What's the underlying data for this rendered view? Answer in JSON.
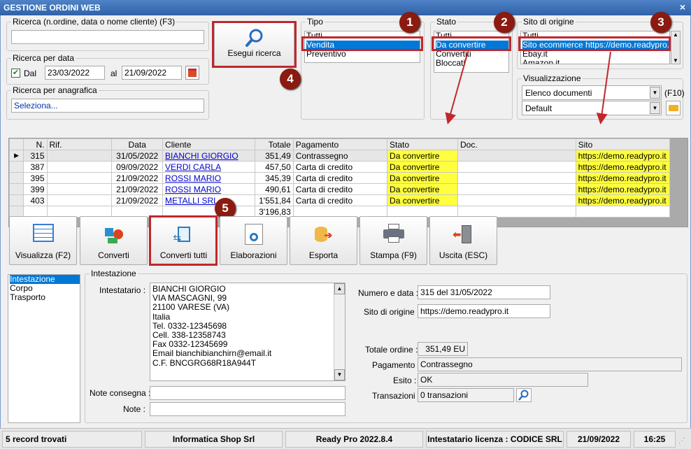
{
  "window": {
    "title": "GESTIONE ORDINI WEB",
    "close": "×"
  },
  "ricerca": {
    "label": "Ricerca (n.ordine, data o nome cliente) (F3)",
    "value": ""
  },
  "ricerca_data": {
    "label": "Ricerca per data",
    "dal_label": "Dal",
    "dal": "23/03/2022",
    "al_label": "al",
    "al": "21/09/2022",
    "dal_checked": true
  },
  "anagrafica": {
    "label": "Ricerca per anagrafica",
    "value": "Seleziona..."
  },
  "search_button": "Esegui ricerca",
  "tipo": {
    "label": "Tipo",
    "items": [
      "Tutti",
      "Vendita",
      "Preventivo"
    ],
    "selected": "Vendita"
  },
  "stato": {
    "label": "Stato",
    "items": [
      "Tutti",
      "Da convertire",
      "Convertiti",
      "Bloccati"
    ],
    "selected": "Da convertire"
  },
  "sito": {
    "label": "Sito di origine",
    "items": [
      "Tutti",
      "Sito ecommerce https://demo.readypro.it",
      "Ebay.it",
      "Amazon.it"
    ],
    "selected": "Sito ecommerce https://demo.readypro.it"
  },
  "visualizzazione": {
    "label": "Visualizzazione",
    "combo1": "Elenco documenti",
    "f10": "(F10)",
    "combo2": "Default"
  },
  "badges": [
    "1",
    "2",
    "3",
    "4",
    "5"
  ],
  "grid": {
    "columns": [
      "N.",
      "Rif.",
      "Data",
      "Cliente",
      "Totale",
      "Pagamento",
      "Stato",
      "Doc.",
      "Sito"
    ],
    "rows": [
      {
        "n": "315",
        "rif": "",
        "data": "31/05/2022",
        "cliente": "BIANCHI GIORGIO",
        "totale": "351,49",
        "pagamento": "Contrassegno",
        "stato": "Da convertire",
        "doc": "",
        "sito": "https://demo.readypro.it"
      },
      {
        "n": "387",
        "rif": "",
        "data": "09/09/2022",
        "cliente": "VERDI CARLA",
        "totale": "457,50",
        "pagamento": "Carta di credito",
        "stato": "Da convertire",
        "doc": "",
        "sito": "https://demo.readypro.it"
      },
      {
        "n": "395",
        "rif": "",
        "data": "21/09/2022",
        "cliente": "ROSSI MARIO",
        "totale": "345,39",
        "pagamento": "Carta di credito",
        "stato": "Da convertire",
        "doc": "",
        "sito": "https://demo.readypro.it"
      },
      {
        "n": "399",
        "rif": "",
        "data": "21/09/2022",
        "cliente": "ROSSI MARIO",
        "totale": "490,61",
        "pagamento": "Carta di credito",
        "stato": "Da convertire",
        "doc": "",
        "sito": "https://demo.readypro.it"
      },
      {
        "n": "403",
        "rif": "",
        "data": "21/09/2022",
        "cliente": "METALLI SRL",
        "totale": "1'551,84",
        "pagamento": "Carta di credito",
        "stato": "Da convertire",
        "doc": "",
        "sito": "https://demo.readypro.it"
      }
    ],
    "total": "3'196,83"
  },
  "toolbar": [
    "Visualizza (F2)",
    "Converti",
    "Converti tutti",
    "Elaborazioni",
    "Esporta",
    "Stampa (F9)",
    "Uscita (ESC)"
  ],
  "nav": [
    "Intestazione",
    "Corpo",
    "Trasporto"
  ],
  "detail": {
    "group_label": "Intestazione",
    "intestatario_label": "Intestatario :",
    "intestatario_lines": [
      "BIANCHI GIORGIO",
      "VIA MASCAGNI, 99",
      "21100 VARESE (VA)",
      "Italia",
      "Tel. 0332-12345698",
      "Cell. 338-12358743",
      "Fax 0332-12345699",
      "Email bianchibianchirn@email.it",
      "C.F. BNCGRG68R18A944T"
    ],
    "note_consegna_label": "Note consegna :",
    "note_consegna": "",
    "note_label": "Note :",
    "note": "",
    "numero_label": "Numero e data :",
    "numero": "315 del 31/05/2022",
    "sito_label": "Sito di origine :",
    "sito": "https://demo.readypro.it",
    "totale_label": "Totale ordine :",
    "totale": "351,49 EU",
    "pagamento_label": "Pagamento :",
    "pagamento": "Contrassegno",
    "esito_label": "Esito :",
    "esito": "OK",
    "transazioni_label": "Transazioni :",
    "transazioni": "0 transazioni"
  },
  "status": {
    "records": "5 record trovati",
    "company": "Informatica Shop Srl",
    "version": "Ready Pro 2022.8.4",
    "license": "Intestatario licenza : CODICE SRL",
    "date": "21/09/2022",
    "time": "16:25"
  },
  "colors": {
    "accent": "#c1272d",
    "badge": "#8b1a10",
    "highlight": "#ffff3f",
    "selection": "#0078d7"
  }
}
